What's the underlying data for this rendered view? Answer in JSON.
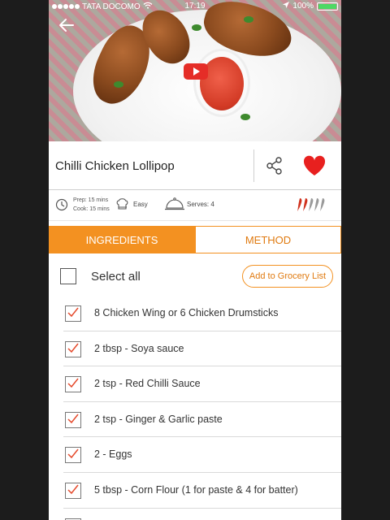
{
  "status_bar": {
    "carrier": "TATA DOCOMO",
    "time": "17:19",
    "battery": "100%"
  },
  "recipe": {
    "title": "Chilli Chicken Lollipop",
    "prep_time": "Prep: 15 mins",
    "cook_time": "Cook: 15 mins",
    "difficulty": "Easy",
    "serves": "Serves: 4",
    "spice_level": {
      "filled": 2,
      "total": 5
    },
    "favorite": true
  },
  "tabs": [
    {
      "label": "INGREDIENTS",
      "active": true
    },
    {
      "label": "METHOD",
      "active": false
    }
  ],
  "select_all": {
    "label": "Select all",
    "checked": false
  },
  "grocery_button": "Add to Grocery List",
  "ingredients": [
    {
      "text": "8 Chicken Wing or 6 Chicken Drumsticks",
      "checked": true
    },
    {
      "text": "2 tbsp - Soya sauce",
      "checked": true
    },
    {
      "text": "2 tsp - Red Chilli Sauce",
      "checked": true
    },
    {
      "text": "2 tsp - Ginger & Garlic paste",
      "checked": true
    },
    {
      "text": "2 - Eggs",
      "checked": true
    },
    {
      "text": "5 tbsp - Corn Flour (1 for paste & 4 for batter)",
      "checked": true
    }
  ],
  "colors": {
    "accent": "#f39121",
    "heart": "#e8201f",
    "chili": "#d0321e"
  },
  "icons": {
    "back": "arrow-left",
    "play": "youtube-play",
    "share": "share",
    "favorite": "heart",
    "time": "clock",
    "difficulty": "chef-hat",
    "serves": "cloche",
    "spice": "chili-pepper",
    "check": "checkmark"
  }
}
